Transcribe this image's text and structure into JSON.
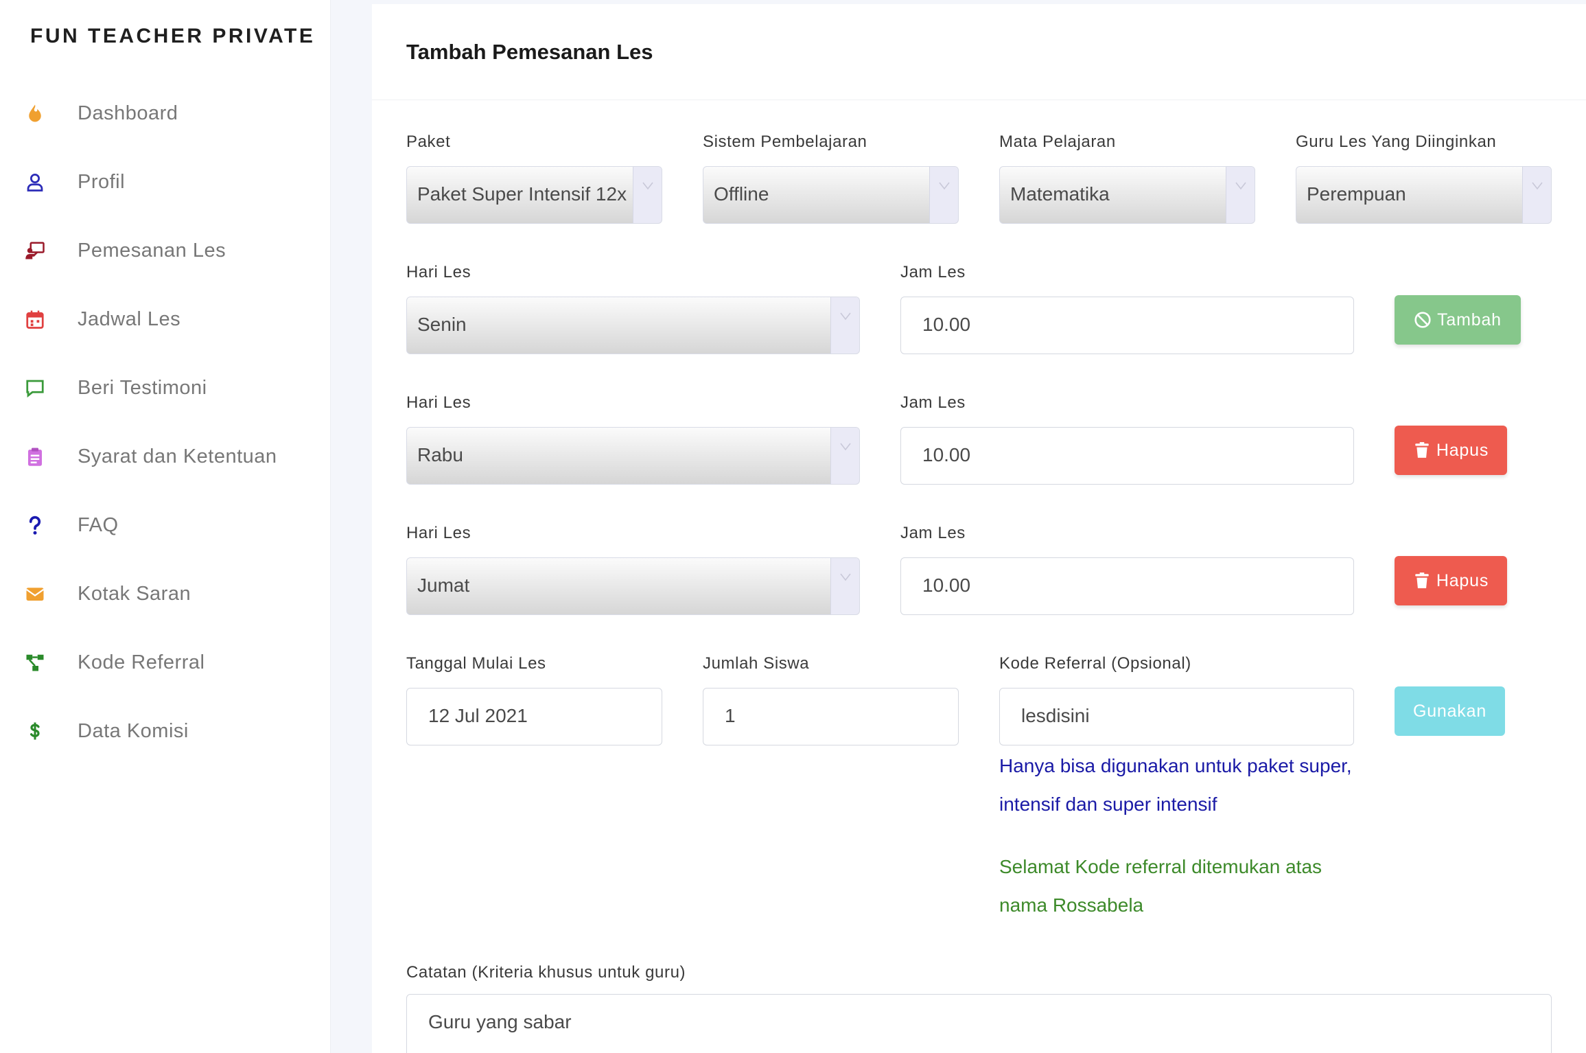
{
  "sidebar": {
    "brand": "FUN TEACHER PRIVATE",
    "items": [
      {
        "label": "Dashboard",
        "icon": "flame-icon",
        "color": "#f0a030"
      },
      {
        "label": "Profil",
        "icon": "user-icon",
        "color": "#2c2cb8"
      },
      {
        "label": "Pemesanan Les",
        "icon": "teacher-board-icon",
        "color": "#9a1a2a"
      },
      {
        "label": "Jadwal Les",
        "icon": "calendar-icon",
        "color": "#e04040"
      },
      {
        "label": "Beri Testimoni",
        "icon": "comment-icon",
        "color": "#3a9a3a"
      },
      {
        "label": "Syarat dan Ketentuan",
        "icon": "clipboard-icon",
        "color": "#d070e0"
      },
      {
        "label": "FAQ",
        "icon": "question-icon",
        "color": "#1a1ab0"
      },
      {
        "label": "Kotak Saran",
        "icon": "envelope-icon",
        "color": "#f0a030"
      },
      {
        "label": "Kode Referral",
        "icon": "network-icon",
        "color": "#2a8a2a"
      },
      {
        "label": "Data Komisi",
        "icon": "dollar-icon",
        "color": "#2a8a2a"
      }
    ]
  },
  "form": {
    "title": "Tambah Pemesanan Les",
    "paket": {
      "label": "Paket",
      "value": "Paket Super Intensif 12x"
    },
    "sistem": {
      "label": "Sistem Pembelajaran",
      "value": "Offline"
    },
    "mapel": {
      "label": "Mata Pelajaran",
      "value": "Matematika"
    },
    "guru": {
      "label": "Guru Les Yang Diinginkan",
      "value": "Perempuan"
    },
    "schedule": [
      {
        "day_label": "Hari Les",
        "day": "Senin",
        "time_label": "Jam Les",
        "time": "10.00",
        "action": "Tambah"
      },
      {
        "day_label": "Hari Les",
        "day": "Rabu",
        "time_label": "Jam Les",
        "time": "10.00",
        "action": "Hapus"
      },
      {
        "day_label": "Hari Les",
        "day": "Jumat",
        "time_label": "Jam Les",
        "time": "10.00",
        "action": "Hapus"
      }
    ],
    "tanggal": {
      "label": "Tanggal Mulai Les",
      "value": "12 Jul 2021"
    },
    "jumlah": {
      "label": "Jumlah Siswa",
      "value": "1"
    },
    "referral": {
      "label": "Kode Referral (Opsional)",
      "value": "lesdisini",
      "button": "Gunakan",
      "note_line1": "Hanya bisa digunakan untuk paket super,",
      "note_line2": "intensif dan super intensif",
      "success_line1": "Selamat Kode referral ditemukan atas",
      "success_line2": "nama Rossabela"
    },
    "catatan": {
      "label": "Catatan (Kriteria khusus untuk guru)",
      "value": "Guru yang sabar"
    }
  }
}
